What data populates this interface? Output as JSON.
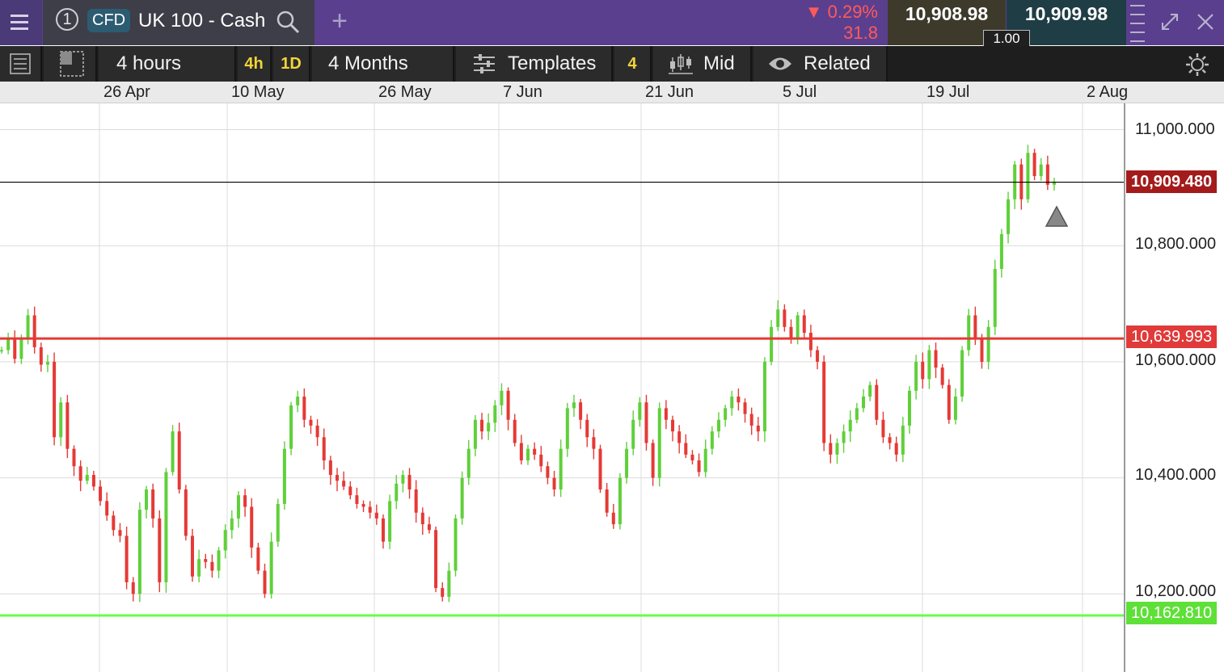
{
  "header": {
    "instrument_number": "1",
    "instrument_type": "CFD",
    "instrument_name": "UK 100 - Cash",
    "change_percent": "0.29%",
    "change_direction": "down",
    "change_absolute": "31.8",
    "sell_price": "10,908.98",
    "buy_price": "10,909.98",
    "quantity": "1.00",
    "icons": [
      "menu-icon",
      "search-icon",
      "plus-icon",
      "expand-icon",
      "close-icon"
    ]
  },
  "toolbar": {
    "interval_label": "4 hours",
    "interval_4h": "4h",
    "interval_1d": "1D",
    "range_label": "4 Months",
    "templates_label": "Templates",
    "indicator_count": "4",
    "price_type_label": "Mid",
    "related_label": "Related",
    "icons": [
      "list-icon",
      "layout-icon",
      "sliders-icon",
      "candlestick-icon",
      "eye-icon",
      "settings-icon"
    ]
  },
  "colors": {
    "header_bg": "#5a3f8e",
    "up_candle": "#5fd03a",
    "down_candle": "#e53935",
    "resistance_line": "#e53935",
    "support_line": "#66ff44",
    "current_line": "#000000",
    "current_tag": "#a31b1b"
  },
  "chart_data": {
    "type": "candlestick",
    "x_tick_labels": [
      "26 Apr",
      "10 May",
      "26 May",
      "7 Jun",
      "21 Jun",
      "5 Jul",
      "19 Jul",
      "2 Aug"
    ],
    "y_tick_labels": [
      "11,000.000",
      "10,800.000",
      "10,600.000",
      "10,400.000",
      "10,200.000"
    ],
    "y_range": [
      10080,
      11050
    ],
    "grid": true,
    "lines": {
      "current_price": "10,909.480",
      "resistance": "10,639.993",
      "support": "10,162.810"
    },
    "current_value": 10909.48,
    "resistance_value": 10639.993,
    "support_value": 10162.81,
    "series": [
      {
        "values": [
          10620,
          10640,
          10605,
          10640,
          10680,
          10625,
          10595,
          10600,
          10470,
          10530,
          10450,
          10420,
          10395,
          10405,
          10385,
          10360,
          10335,
          10310,
          10300,
          10220,
          10200,
          10345,
          10380,
          10330,
          10220,
          10410,
          10480,
          10380,
          10300,
          10230,
          10260,
          10255,
          10240,
          10275,
          10310,
          10330,
          10370,
          10350,
          10280,
          10240,
          10200,
          10290,
          10355,
          10450,
          10525,
          10540,
          10500,
          10490,
          10470,
          10430,
          10405,
          10395,
          10385,
          10370,
          10355,
          10350,
          10340,
          10330,
          10290,
          10360,
          10390,
          10405,
          10380,
          10340,
          10320,
          10310,
          10210,
          10195,
          10240,
          10330,
          10400,
          10450,
          10500,
          10480,
          10495,
          10525,
          10550,
          10500,
          10460,
          10430,
          10450,
          10440,
          10420,
          10400,
          10380,
          10450,
          10520,
          10530,
          10500,
          10470,
          10450,
          10380,
          10340,
          10320,
          10400,
          10450,
          10500,
          10530,
          10460,
          10400,
          10520,
          10500,
          10480,
          10460,
          10440,
          10430,
          10410,
          10450,
          10480,
          10500,
          10520,
          10540,
          10530,
          10510,
          10490,
          10480,
          10600,
          10660,
          10690,
          10660,
          10640,
          10680,
          10650,
          10620,
          10600,
          10460,
          10440,
          10460,
          10480,
          10500,
          10520,
          10540,
          10560,
          10500,
          10470,
          10460,
          10440,
          10490,
          10550,
          10600,
          10570,
          10620,
          10590,
          10560,
          10500,
          10540,
          10620,
          10680,
          10640,
          10600,
          10660,
          10760,
          10820,
          10880,
          10940,
          10880,
          10960,
          10920,
          10940,
          10905,
          10909
        ]
      }
    ]
  }
}
